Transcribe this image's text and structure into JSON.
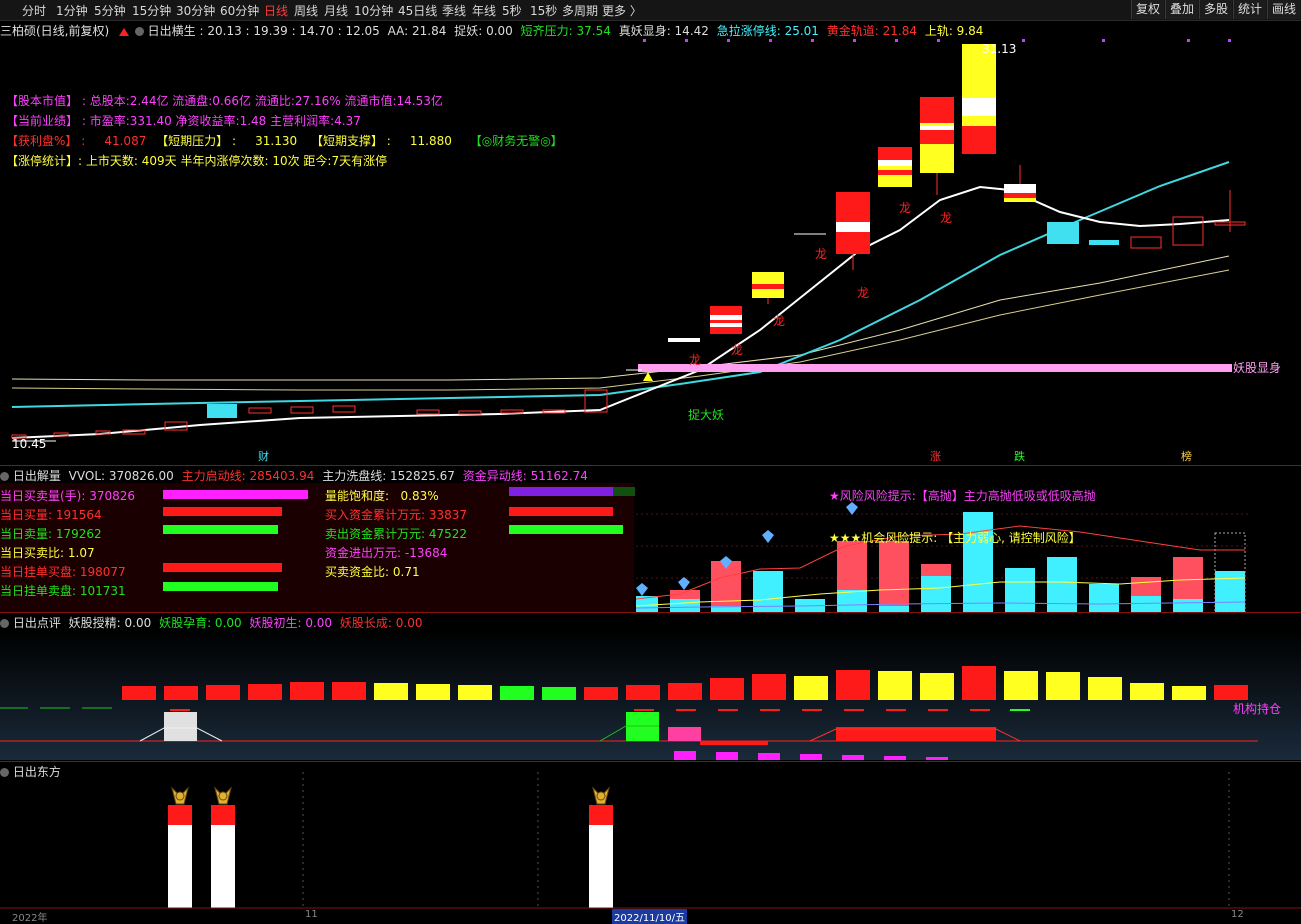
{
  "toolbar": {
    "timeframes": [
      "分时",
      "1分钟",
      "5分钟",
      "15分钟",
      "30分钟",
      "60分钟",
      "日线",
      "周线",
      "月线",
      "10分钟",
      "45日线",
      "季线",
      "年线",
      "5秒",
      "15秒",
      "多周期",
      "更多 〉"
    ],
    "active": "日线",
    "buttons": [
      "复权",
      "叠加",
      "多股",
      "统计",
      "画线"
    ]
  },
  "main": {
    "stock_title": "三柏硕(日线,前复权)",
    "indicator_name": "日出横生",
    "values_text": ": 20.13 : 19.39 : 14.70 : 12.05",
    "aa": "AA: 21.84",
    "zhuoyao": "捉妖: 0.00",
    "dqyl": "短齐压力: 37.54",
    "zyxs": "真妖显身: 14.42",
    "jlztx": "急拉涨停线: 25.01",
    "hjgd": "黄金轨道: 21.84",
    "sg": "上轨: 9.84",
    "info1_label": "【股本市值】",
    "info1_text": "总股本:2.44亿 流通盘:0.66亿 流通比:27.16% 流通市值:14.53亿",
    "info2_label": "【当前业绩】",
    "info2_text": "市盈率:331.40 净资收益率:1.48 主营利润率:4.37",
    "info3_label": "【获利盘%】",
    "info3_value": "41.087",
    "info3b_label": "【短期压力】",
    "info3b_value": "31.130",
    "info3c_label": "【短期支撑】",
    "info3c_value": "11.880",
    "info3d": "【◎财务无警◎】",
    "info4_label": "【涨停统计】",
    "info4_text": "上市天数: 409天 半年内涨停次数: 10次   距今:7天有涨停",
    "high_label": "31.13",
    "low_label": "10.45",
    "yaogu_label": "妖股显身",
    "zhuoyao_label": "捉大妖",
    "long_labels": [
      "龙",
      "龙",
      "龙",
      "龙",
      "龙",
      "龙",
      "龙"
    ],
    "bottom_labels": {
      "cai": "财",
      "zhang": "涨",
      "die": "跌",
      "bang": "榜"
    }
  },
  "panel2": {
    "name": "日出解量",
    "vvol": "VVOL: 370826.00",
    "zlqd": "主力启动线: 285403.94",
    "zlxp": "主力洗盘线: 152825.67",
    "zjyd": "资金异动线: 51162.74",
    "left_rows": [
      {
        "label": "当日买卖量(手):",
        "value": "370826"
      },
      {
        "label": "当日买量:",
        "value": "191564"
      },
      {
        "label": "当日卖量:",
        "value": "179262"
      },
      {
        "label": "当日买卖比:",
        "value": "1.07"
      },
      {
        "label": "当日挂单买盘:",
        "value": "198077"
      },
      {
        "label": "当日挂单卖盘:",
        "value": "101731"
      }
    ],
    "mid_rows": [
      {
        "label": "量能饱和度:",
        "value": "0.83%"
      },
      {
        "label": "买入资金累计万元:",
        "value": "33837"
      },
      {
        "label": "卖出资金累计万元:",
        "value": "47522"
      },
      {
        "label": "资金进出万元:",
        "value": "-13684"
      },
      {
        "label": "买卖资金比:",
        "value": "0.71"
      }
    ],
    "risk_tip": "★风险风险提示:【高抛】主力高抛低吸或低吸高抛",
    "chance_tip": "★★★机会风险提示: 【主力弱心, 请控制风险】"
  },
  "panel3": {
    "name": "日出点评",
    "ygsj": "妖股授精: 0.00",
    "ygyy": "妖股孕育: 0.00",
    "ygcs": "妖股初生: 0.00",
    "yzcc": "妖股长成: 0.00",
    "jgcc": "机构持仓"
  },
  "panel4": {
    "name": "日出东方"
  },
  "axis": {
    "labels": [
      "2022年",
      "11",
      "2022/11/10/五",
      "12"
    ]
  },
  "colors": {
    "red": "#ff1a1a",
    "cyan": "#3ff3ff",
    "yellow": "#ffff20",
    "white": "#ffffff",
    "magenta": "#ff40ff",
    "green": "#20ff20",
    "pink": "#ff9aff"
  }
}
